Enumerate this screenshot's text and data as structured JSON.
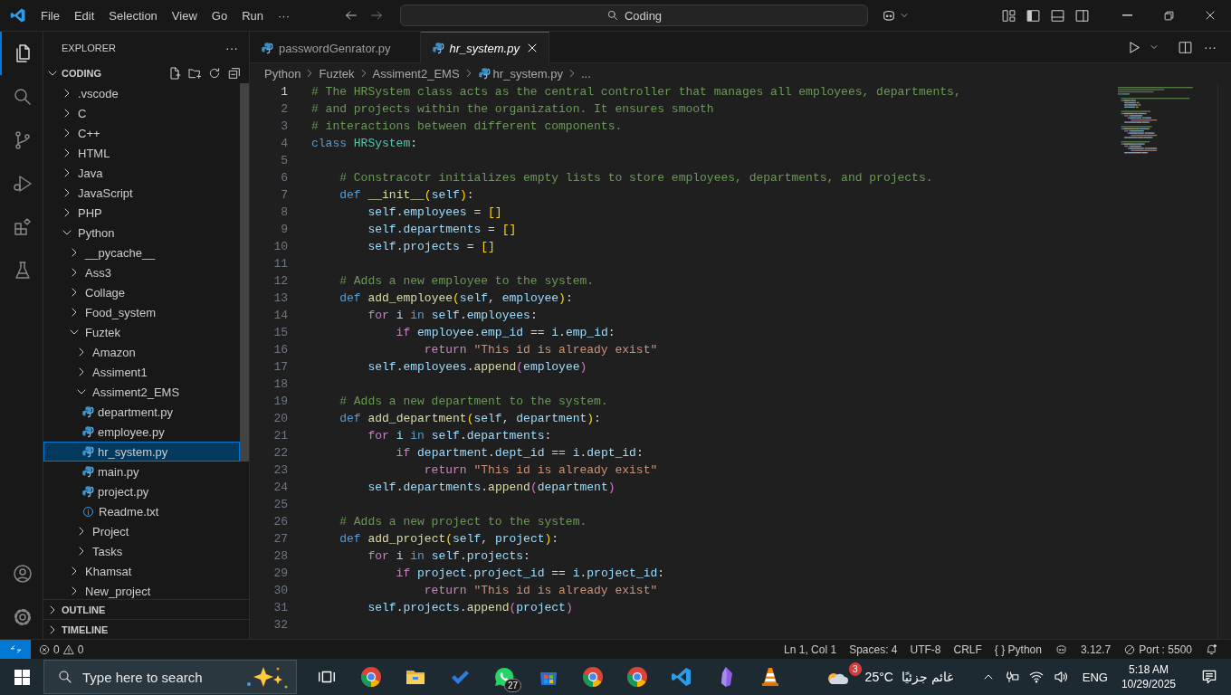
{
  "title_bar": {
    "menus": [
      "File",
      "Edit",
      "Selection",
      "View",
      "Go",
      "Run",
      "···"
    ],
    "search": "Coding"
  },
  "activity_bar": {
    "items": [
      {
        "kind": "files",
        "selected": true
      },
      {
        "kind": "search",
        "selected": false
      },
      {
        "kind": "branch",
        "selected": false
      },
      {
        "kind": "debug",
        "selected": false
      },
      {
        "kind": "extensions",
        "selected": false
      },
      {
        "kind": "flask",
        "selected": false
      }
    ],
    "bottom": [
      {
        "kind": "account"
      },
      {
        "kind": "settings"
      }
    ]
  },
  "sidebar": {
    "title": "EXPLORER",
    "more": "···",
    "folder": {
      "label": "CODING",
      "expanded": true
    },
    "tree": [
      {
        "label": ".vscode",
        "kind": "folder",
        "expanded": false,
        "selected": false
      },
      {
        "label": "C",
        "kind": "folder",
        "expanded": false,
        "selected": false
      },
      {
        "label": "C++",
        "kind": "folder",
        "expanded": false,
        "selected": false
      },
      {
        "label": "HTML",
        "kind": "folder",
        "expanded": false,
        "selected": false
      },
      {
        "label": "Java",
        "kind": "folder",
        "expanded": false,
        "selected": false
      },
      {
        "label": "JavaScript",
        "kind": "folder",
        "expanded": false,
        "selected": false
      },
      {
        "label": "PHP",
        "kind": "folder",
        "expanded": false,
        "selected": false
      },
      {
        "label": "Python",
        "kind": "folder",
        "expanded": true,
        "selected": false,
        "children": [
          {
            "label": "__pycache__",
            "kind": "folder",
            "expanded": false,
            "selected": false
          },
          {
            "label": "Ass3",
            "kind": "folder",
            "expanded": false,
            "selected": false
          },
          {
            "label": "Collage",
            "kind": "folder",
            "expanded": false,
            "selected": false
          },
          {
            "label": "Food_system",
            "kind": "folder",
            "expanded": false,
            "selected": false
          },
          {
            "label": "Fuztek",
            "kind": "folder",
            "expanded": true,
            "selected": false,
            "children": [
              {
                "label": "Amazon",
                "kind": "folder",
                "expanded": false,
                "selected": false
              },
              {
                "label": "Assiment1",
                "kind": "folder",
                "expanded": false,
                "selected": false
              },
              {
                "label": "Assiment2_EMS",
                "kind": "folder",
                "expanded": true,
                "selected": false,
                "children": [
                  {
                    "label": "department.py",
                    "kind": "python",
                    "selected": false
                  },
                  {
                    "label": "employee.py",
                    "kind": "python",
                    "selected": false
                  },
                  {
                    "label": "hr_system.py",
                    "kind": "python",
                    "selected": true
                  },
                  {
                    "label": "main.py",
                    "kind": "python",
                    "selected": false
                  },
                  {
                    "label": "project.py",
                    "kind": "python",
                    "selected": false
                  },
                  {
                    "label": "Readme.txt",
                    "kind": "text",
                    "selected": false
                  }
                ]
              },
              {
                "label": "Project",
                "kind": "folder",
                "expanded": false,
                "selected": false
              },
              {
                "label": "Tasks",
                "kind": "folder",
                "expanded": false,
                "selected": false
              }
            ]
          },
          {
            "label": "Khamsat",
            "kind": "folder",
            "expanded": false,
            "selected": false
          },
          {
            "label": "New_project",
            "kind": "folder",
            "expanded": false,
            "selected": false
          }
        ]
      }
    ],
    "sections": [
      {
        "label": "OUTLINE",
        "expanded": false
      },
      {
        "label": "TIMELINE",
        "expanded": false
      }
    ]
  },
  "tabs": [
    {
      "label": "passwordGenrator.py",
      "selected": false,
      "preview": false
    },
    {
      "label": "hr_system.py",
      "selected": true,
      "preview": true
    }
  ],
  "editor_actions": {
    "more": "···"
  },
  "breadcrumbs": [
    {
      "label": "Python",
      "kind": "folder"
    },
    {
      "label": "Fuztek",
      "kind": "folder"
    },
    {
      "label": "Assiment2_EMS",
      "kind": "folder"
    },
    {
      "label": "hr_system.py",
      "kind": "python"
    },
    {
      "label": "...",
      "kind": "more"
    }
  ],
  "code": {
    "lines": [
      {
        "number": "1",
        "current": true,
        "tokens": [
          {
            "kind": "comment",
            "text": "# The HRSystem class acts as the central controller that manages all employees, departments,"
          }
        ]
      },
      {
        "number": "2",
        "current": false,
        "tokens": [
          {
            "kind": "comment",
            "text": "# and projects within the organization. It ensures smooth"
          }
        ]
      },
      {
        "number": "3",
        "current": false,
        "tokens": [
          {
            "kind": "comment",
            "text": "# interactions between different components."
          }
        ]
      },
      {
        "number": "4",
        "current": false,
        "tokens": [
          {
            "kind": "keyword",
            "text": "class "
          },
          {
            "kind": "class",
            "text": "HRSystem"
          },
          {
            "kind": "plain",
            "text": ":"
          }
        ]
      },
      {
        "number": "5",
        "current": false
      },
      {
        "number": "6",
        "current": false,
        "tokens": [
          {
            "kind": "comment",
            "text": "    # Constracotr initializes empty lists to store employees, departments, and projects."
          }
        ]
      },
      {
        "number": "7",
        "current": false,
        "tokens": [
          {
            "kind": "keyword",
            "text": "    def "
          },
          {
            "kind": "function",
            "text": "__init__"
          },
          {
            "kind": "bracket",
            "text": "("
          },
          {
            "kind": "variable",
            "text": "self"
          },
          {
            "kind": "bracket",
            "text": ")"
          },
          {
            "kind": "plain",
            "text": ":"
          }
        ]
      },
      {
        "number": "8",
        "current": false,
        "tokens": [
          {
            "kind": "variable",
            "text": "        self"
          },
          {
            "kind": "plain",
            "text": "."
          },
          {
            "kind": "variable",
            "text": "employees"
          },
          {
            "kind": "plain",
            "text": " = "
          },
          {
            "kind": "bracket",
            "text": "[]"
          }
        ]
      },
      {
        "number": "9",
        "current": false,
        "tokens": [
          {
            "kind": "variable",
            "text": "        self"
          },
          {
            "kind": "plain",
            "text": "."
          },
          {
            "kind": "variable",
            "text": "departments"
          },
          {
            "kind": "plain",
            "text": " = "
          },
          {
            "kind": "bracket",
            "text": "[]"
          }
        ]
      },
      {
        "number": "10",
        "current": false,
        "tokens": [
          {
            "kind": "variable",
            "text": "        self"
          },
          {
            "kind": "plain",
            "text": "."
          },
          {
            "kind": "variable",
            "text": "projects"
          },
          {
            "kind": "plain",
            "text": " = "
          },
          {
            "kind": "bracket",
            "text": "[]"
          }
        ]
      },
      {
        "number": "11",
        "current": false
      },
      {
        "number": "12",
        "current": false,
        "tokens": [
          {
            "kind": "comment",
            "text": "    # Adds a new employee to the system."
          }
        ]
      },
      {
        "number": "13",
        "current": false,
        "tokens": [
          {
            "kind": "keyword",
            "text": "    def "
          },
          {
            "kind": "function",
            "text": "add_employee"
          },
          {
            "kind": "bracket",
            "text": "("
          },
          {
            "kind": "variable",
            "text": "self"
          },
          {
            "kind": "plain",
            "text": ", "
          },
          {
            "kind": "variable",
            "text": "employee"
          },
          {
            "kind": "bracket",
            "text": ")"
          },
          {
            "kind": "plain",
            "text": ":"
          }
        ]
      },
      {
        "number": "14",
        "current": false,
        "tokens": [
          {
            "kind": "control",
            "text": "        for "
          },
          {
            "kind": "variable",
            "text": "i"
          },
          {
            "kind": "keyword",
            "text": " in "
          },
          {
            "kind": "variable",
            "text": "self"
          },
          {
            "kind": "plain",
            "text": "."
          },
          {
            "kind": "variable",
            "text": "employees"
          },
          {
            "kind": "plain",
            "text": ":"
          }
        ]
      },
      {
        "number": "15",
        "current": false,
        "tokens": [
          {
            "kind": "control",
            "text": "            if "
          },
          {
            "kind": "variable",
            "text": "employee"
          },
          {
            "kind": "plain",
            "text": "."
          },
          {
            "kind": "variable",
            "text": "emp_id"
          },
          {
            "kind": "plain",
            "text": " == "
          },
          {
            "kind": "variable",
            "text": "i"
          },
          {
            "kind": "plain",
            "text": "."
          },
          {
            "kind": "variable",
            "text": "emp_id"
          },
          {
            "kind": "plain",
            "text": ":"
          }
        ]
      },
      {
        "number": "16",
        "current": false,
        "tokens": [
          {
            "kind": "control",
            "text": "                return "
          },
          {
            "kind": "string",
            "text": "\"This id is already exist\""
          }
        ]
      },
      {
        "number": "17",
        "current": false,
        "tokens": [
          {
            "kind": "variable",
            "text": "        self"
          },
          {
            "kind": "plain",
            "text": "."
          },
          {
            "kind": "variable",
            "text": "employees"
          },
          {
            "kind": "plain",
            "text": "."
          },
          {
            "kind": "function",
            "text": "append"
          },
          {
            "kind": "bracket2",
            "text": "("
          },
          {
            "kind": "variable",
            "text": "employee"
          },
          {
            "kind": "bracket2",
            "text": ")"
          }
        ]
      },
      {
        "number": "18",
        "current": false
      },
      {
        "number": "19",
        "current": false,
        "tokens": [
          {
            "kind": "comment",
            "text": "    # Adds a new department to the system."
          }
        ]
      },
      {
        "number": "20",
        "current": false,
        "tokens": [
          {
            "kind": "keyword",
            "text": "    def "
          },
          {
            "kind": "function",
            "text": "add_department"
          },
          {
            "kind": "bracket",
            "text": "("
          },
          {
            "kind": "variable",
            "text": "self"
          },
          {
            "kind": "plain",
            "text": ", "
          },
          {
            "kind": "variable",
            "text": "department"
          },
          {
            "kind": "bracket",
            "text": ")"
          },
          {
            "kind": "plain",
            "text": ":"
          }
        ]
      },
      {
        "number": "21",
        "current": false,
        "tokens": [
          {
            "kind": "control",
            "text": "        for "
          },
          {
            "kind": "variable",
            "text": "i"
          },
          {
            "kind": "keyword",
            "text": " in "
          },
          {
            "kind": "variable",
            "text": "self"
          },
          {
            "kind": "plain",
            "text": "."
          },
          {
            "kind": "variable",
            "text": "departments"
          },
          {
            "kind": "plain",
            "text": ":"
          }
        ]
      },
      {
        "number": "22",
        "current": false,
        "tokens": [
          {
            "kind": "control",
            "text": "            if "
          },
          {
            "kind": "variable",
            "text": "department"
          },
          {
            "kind": "plain",
            "text": "."
          },
          {
            "kind": "variable",
            "text": "dept_id"
          },
          {
            "kind": "plain",
            "text": " == "
          },
          {
            "kind": "variable",
            "text": "i"
          },
          {
            "kind": "plain",
            "text": "."
          },
          {
            "kind": "variable",
            "text": "dept_id"
          },
          {
            "kind": "plain",
            "text": ":"
          }
        ]
      },
      {
        "number": "23",
        "current": false,
        "tokens": [
          {
            "kind": "control",
            "text": "                return "
          },
          {
            "kind": "string",
            "text": "\"This id is already exist\""
          }
        ]
      },
      {
        "number": "24",
        "current": false,
        "tokens": [
          {
            "kind": "variable",
            "text": "        self"
          },
          {
            "kind": "plain",
            "text": "."
          },
          {
            "kind": "variable",
            "text": "departments"
          },
          {
            "kind": "plain",
            "text": "."
          },
          {
            "kind": "function",
            "text": "append"
          },
          {
            "kind": "bracket2",
            "text": "("
          },
          {
            "kind": "variable",
            "text": "department"
          },
          {
            "kind": "bracket2",
            "text": ")"
          }
        ]
      },
      {
        "number": "25",
        "current": false
      },
      {
        "number": "26",
        "current": false,
        "tokens": [
          {
            "kind": "comment",
            "text": "    # Adds a new project to the system."
          }
        ]
      },
      {
        "number": "27",
        "current": false,
        "tokens": [
          {
            "kind": "keyword",
            "text": "    def "
          },
          {
            "kind": "function",
            "text": "add_project"
          },
          {
            "kind": "bracket",
            "text": "("
          },
          {
            "kind": "variable",
            "text": "self"
          },
          {
            "kind": "plain",
            "text": ", "
          },
          {
            "kind": "variable",
            "text": "project"
          },
          {
            "kind": "bracket",
            "text": ")"
          },
          {
            "kind": "plain",
            "text": ":"
          }
        ]
      },
      {
        "number": "28",
        "current": false,
        "tokens": [
          {
            "kind": "control",
            "text": "        for "
          },
          {
            "kind": "variable",
            "text": "i"
          },
          {
            "kind": "keyword",
            "text": " in "
          },
          {
            "kind": "variable",
            "text": "self"
          },
          {
            "kind": "plain",
            "text": "."
          },
          {
            "kind": "variable",
            "text": "projects"
          },
          {
            "kind": "plain",
            "text": ":"
          }
        ]
      },
      {
        "number": "29",
        "current": false,
        "tokens": [
          {
            "kind": "control",
            "text": "            if "
          },
          {
            "kind": "variable",
            "text": "project"
          },
          {
            "kind": "plain",
            "text": "."
          },
          {
            "kind": "variable",
            "text": "project_id"
          },
          {
            "kind": "plain",
            "text": " == "
          },
          {
            "kind": "variable",
            "text": "i"
          },
          {
            "kind": "plain",
            "text": "."
          },
          {
            "kind": "variable",
            "text": "project_id"
          },
          {
            "kind": "plain",
            "text": ":"
          }
        ]
      },
      {
        "number": "30",
        "current": false,
        "tokens": [
          {
            "kind": "control",
            "text": "                return "
          },
          {
            "kind": "string",
            "text": "\"This id is already exist\""
          }
        ]
      },
      {
        "number": "31",
        "current": false,
        "tokens": [
          {
            "kind": "variable",
            "text": "        self"
          },
          {
            "kind": "plain",
            "text": "."
          },
          {
            "kind": "variable",
            "text": "projects"
          },
          {
            "kind": "plain",
            "text": "."
          },
          {
            "kind": "function",
            "text": "append"
          },
          {
            "kind": "bracket2",
            "text": "("
          },
          {
            "kind": "variable",
            "text": "project"
          },
          {
            "kind": "bracket2",
            "text": ")"
          }
        ]
      },
      {
        "number": "32",
        "current": false
      }
    ]
  },
  "status_bar": {
    "errors": "0",
    "warnings": "0",
    "items": [
      {
        "kind": "text",
        "text": "Ln 1, Col 1"
      },
      {
        "kind": "text",
        "text": "Spaces: 4"
      },
      {
        "kind": "text",
        "text": "UTF-8"
      },
      {
        "kind": "text",
        "text": "CRLF"
      },
      {
        "kind": "text",
        "text": "{ } Python"
      },
      {
        "kind": "copilot"
      },
      {
        "kind": "text",
        "text": "3.12.7"
      },
      {
        "kind": "port",
        "text": "Port : 5500"
      },
      {
        "kind": "bell"
      }
    ]
  },
  "taskbar": {
    "search_placeholder": "Type here to search",
    "apps": [
      {
        "kind": "taskview"
      },
      {
        "kind": "chrome"
      },
      {
        "kind": "folder"
      },
      {
        "kind": "todo"
      },
      {
        "kind": "whatsapp",
        "badge": "27"
      },
      {
        "kind": "store"
      },
      {
        "kind": "chrome"
      },
      {
        "kind": "chrome"
      },
      {
        "kind": "vscode"
      },
      {
        "kind": "gem"
      },
      {
        "kind": "cone"
      }
    ],
    "weather": {
      "badge": "3",
      "temperature": "25°C",
      "condition": "غائم جزئيًا"
    },
    "language": "ENG",
    "time": "5:18 AM",
    "date": "10/29/2025"
  }
}
